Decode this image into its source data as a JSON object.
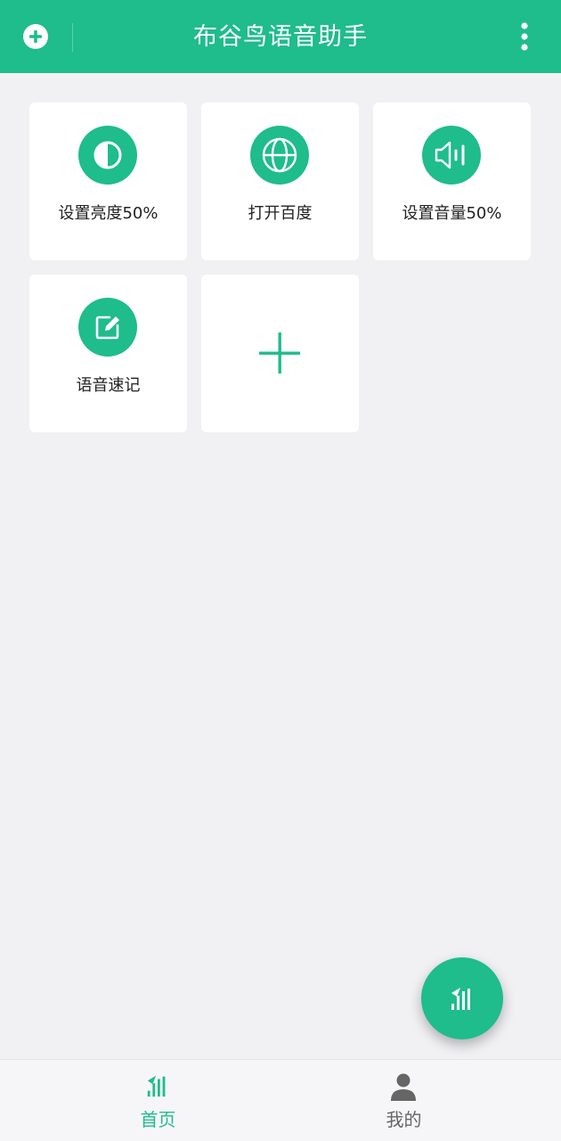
{
  "header": {
    "title": "布谷鸟语音助手",
    "add_icon": "plus-circle-icon",
    "more_icon": "more-vertical-icon"
  },
  "commands": [
    {
      "label": "设置亮度50%",
      "icon": "brightness-icon"
    },
    {
      "label": "打开百度",
      "icon": "globe-icon"
    },
    {
      "label": "设置音量50%",
      "icon": "volume-icon"
    },
    {
      "label": "语音速记",
      "icon": "edit-note-icon"
    }
  ],
  "add_command": {
    "icon": "plus-icon"
  },
  "fab": {
    "icon": "voice-assistant-icon"
  },
  "bottom_nav": {
    "items": [
      {
        "label": "首页",
        "icon": "home-voice-icon",
        "active": true
      },
      {
        "label": "我的",
        "icon": "person-icon",
        "active": false
      }
    ]
  },
  "colors": {
    "accent": "#1fbc8c",
    "background": "#f1f1f4",
    "card": "#ffffff",
    "text": "#222222",
    "nav_inactive": "#666666"
  }
}
